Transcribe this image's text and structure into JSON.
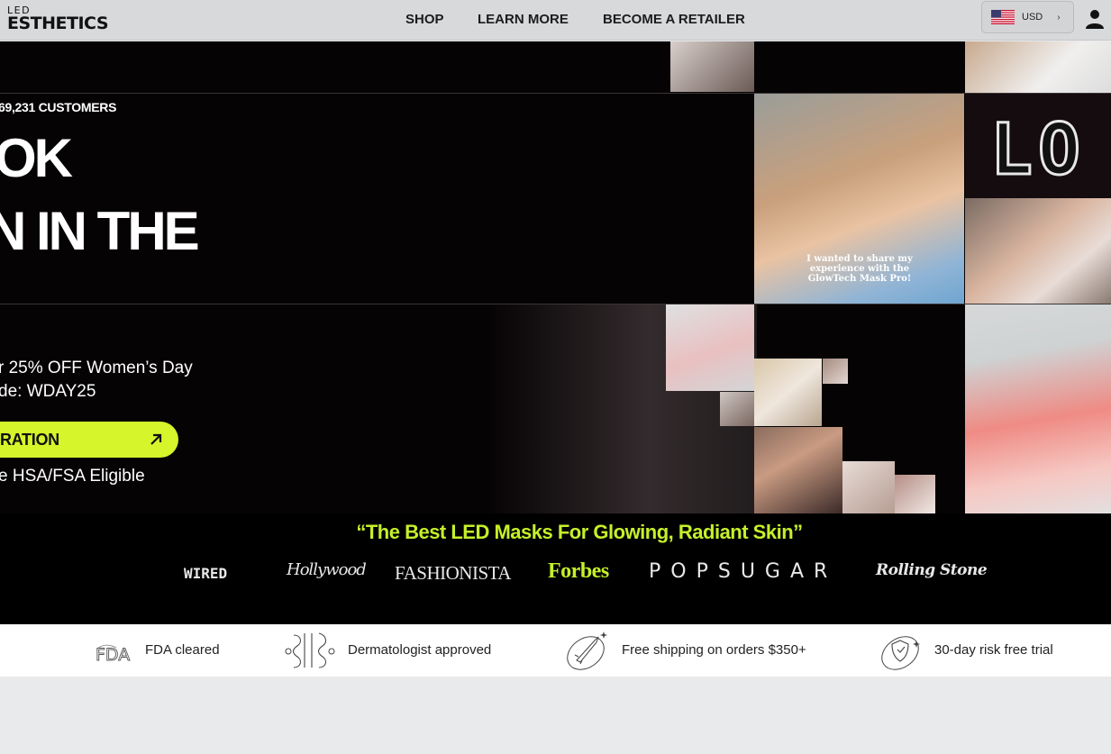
{
  "header": {
    "logo_top": "LED",
    "logo_main": "ESTHETICS",
    "nav": {
      "shop": "SHOP",
      "learn_more": "LEARN MORE",
      "retailer": "BECOME A RETAILER"
    },
    "currency": "USD",
    "icons": {
      "flag": "us-flag-icon",
      "chevron": "chevron-right-icon",
      "account": "account-icon"
    }
  },
  "hero": {
    "customers": "69,231 CUSTOMERS",
    "headline_line1": "OK",
    "headline_line2": "N IN THE",
    "promo_line1": "r 25% OFF Women’s Day",
    "promo_line2": "de: WDAY25",
    "cta_label": "RATION",
    "hsa": "e HSA/FSA Eligible",
    "video_caption": "I wanted to share my experience with the GlowTech Mask Pro!",
    "sign_text": "LO"
  },
  "press": {
    "quote": "“The Best LED Masks For Glowing, Radiant Skin”",
    "logos": {
      "wired": "WIRED",
      "hollywood": "Hollywood",
      "fashionista": "FASHIONISTA",
      "forbes": "Forbes",
      "popsugar": "POPSUGAR",
      "rolling_stone": "Rolling Stone"
    }
  },
  "features": [
    {
      "icon": "fda-icon",
      "label": "FDA cleared"
    },
    {
      "icon": "dermatologist-icon",
      "label": "Dermatologist approved"
    },
    {
      "icon": "rocket-icon",
      "label": "Free shipping on orders $350+"
    },
    {
      "icon": "shield-icon",
      "label": "30-day risk free trial"
    }
  ],
  "colors": {
    "accent": "#d6f52a",
    "quote": "#c5f02a",
    "hero_bg": "#060304",
    "header_bg": "#d7d9db"
  }
}
